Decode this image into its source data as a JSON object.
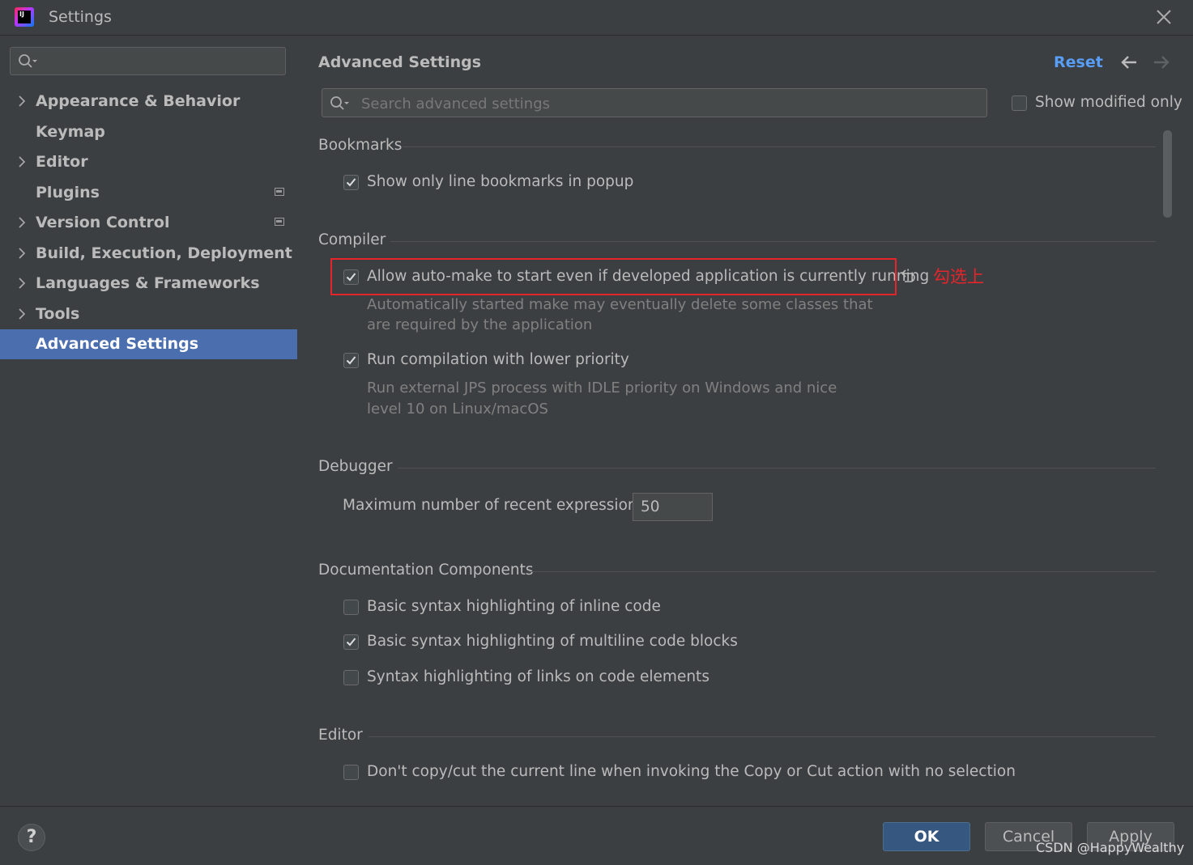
{
  "window": {
    "title": "Settings"
  },
  "sidebar": {
    "search_placeholder": "",
    "items": [
      {
        "label": "Appearance & Behavior",
        "expandable": true,
        "badge": false,
        "selected": false
      },
      {
        "label": "Keymap",
        "expandable": false,
        "badge": false,
        "selected": false
      },
      {
        "label": "Editor",
        "expandable": true,
        "badge": false,
        "selected": false
      },
      {
        "label": "Plugins",
        "expandable": false,
        "badge": true,
        "selected": false
      },
      {
        "label": "Version Control",
        "expandable": true,
        "badge": true,
        "selected": false
      },
      {
        "label": "Build, Execution, Deployment",
        "expandable": true,
        "badge": false,
        "selected": false
      },
      {
        "label": "Languages & Frameworks",
        "expandable": true,
        "badge": false,
        "selected": false
      },
      {
        "label": "Tools",
        "expandable": true,
        "badge": false,
        "selected": false
      },
      {
        "label": "Advanced Settings",
        "expandable": false,
        "badge": false,
        "selected": true
      }
    ]
  },
  "main": {
    "title": "Advanced Settings",
    "reset_label": "Reset",
    "search_placeholder": "Search advanced settings",
    "show_modified_label": "Show modified only",
    "show_modified_checked": false,
    "sections": {
      "bookmarks": {
        "title": "Bookmarks",
        "options": [
          {
            "label": "Show only line bookmarks in popup",
            "checked": true
          }
        ]
      },
      "compiler": {
        "title": "Compiler",
        "options": [
          {
            "label": "Allow auto-make to start even if developed application is currently running",
            "checked": true,
            "desc_line1": "Automatically started make may eventually delete some classes that",
            "desc_line2": "are required by the application"
          },
          {
            "label": "Run compilation with lower priority",
            "checked": true,
            "desc_line1": "Run external JPS process with IDLE priority on Windows and nice",
            "desc_line2": "level 10 on Linux/macOS"
          }
        ]
      },
      "debugger": {
        "title": "Debugger",
        "max_expr_label": "Maximum number of recent expressions:",
        "max_expr_value": "50"
      },
      "documentation": {
        "title": "Documentation Components",
        "options": [
          {
            "label": "Basic syntax highlighting of inline code",
            "checked": false
          },
          {
            "label": "Basic syntax highlighting of multiline code blocks",
            "checked": true
          },
          {
            "label": "Syntax highlighting of links on code elements",
            "checked": false
          }
        ]
      },
      "editor": {
        "title": "Editor",
        "options": [
          {
            "label": "Don't copy/cut the current line when invoking the Copy or Cut action with no selection",
            "checked": false
          }
        ]
      }
    },
    "annotation": "勾选上"
  },
  "buttons": {
    "help": "?",
    "ok": "OK",
    "cancel": "Cancel",
    "apply": "Apply"
  },
  "watermark": "CSDN @HappyWealthy",
  "colors": {
    "accent": "#589df6",
    "selection": "#4b6eaf",
    "highlight_red": "#e5242b",
    "ok_button": "#365880"
  }
}
